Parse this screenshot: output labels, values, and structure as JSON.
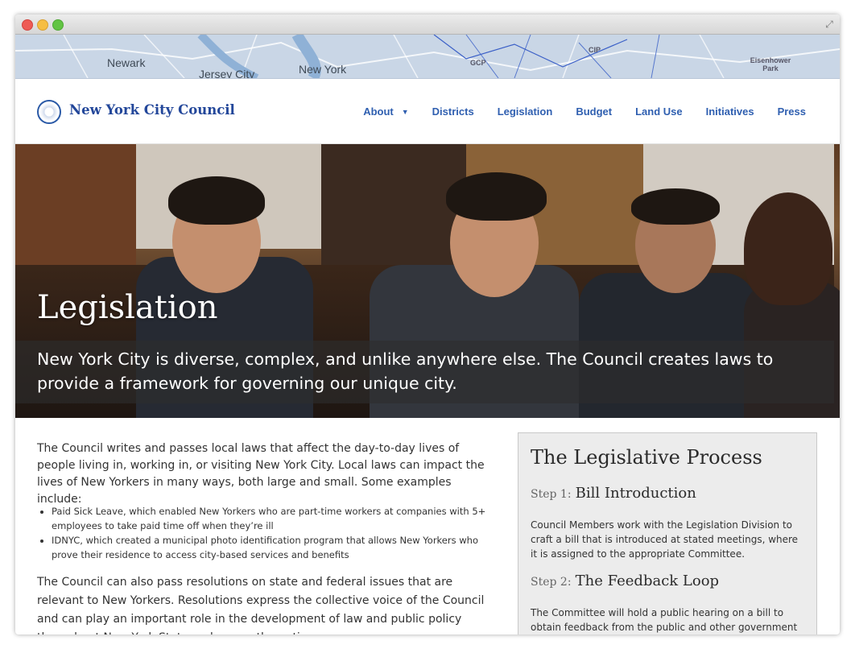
{
  "map": {
    "labels": [
      "Newark",
      "Jersey City",
      "New York",
      "CIP",
      "GCP",
      "Eisenhower Park"
    ]
  },
  "header": {
    "brand": "New York City Council",
    "nav": [
      {
        "label": "About"
      },
      {
        "label": "Districts"
      },
      {
        "label": "Legislation"
      },
      {
        "label": "Budget"
      },
      {
        "label": "Land Use"
      },
      {
        "label": "Initiatives"
      },
      {
        "label": "Press"
      }
    ]
  },
  "hero": {
    "title": "Legislation",
    "subtitle": "New York City is diverse, complex, and unlike anywhere else. The Council creates laws to provide a framework for governing our unique city."
  },
  "main": {
    "intro": "The Council writes and passes local laws that affect the day-to-day lives of people living in, working in, or visiting New York City. Local laws can impact the lives of New Yorkers in many ways, both large and small. Some examples include:",
    "bullets": [
      "Paid Sick Leave, which enabled New Yorkers who are part-time workers at companies with 5+ employees to take paid time off when they’re ill",
      "IDNYC, which created a municipal photo identification program that allows New Yorkers who prove their residence to access city-based services and benefits"
    ],
    "para2": "The Council can also pass resolutions on state and federal issues that are relevant to New Yorkers. Resolutions express the collective voice of the Council and can play an important role in the development of law and public policy throughout New York State and across the nation."
  },
  "sidebar": {
    "title": "The Legislative Process",
    "steps": [
      {
        "num": "Step 1:",
        "name": "Bill Introduction",
        "desc": "Council Members work with the Legislation Division to craft a bill that is introduced at stated meetings, where it is assigned to the appropriate Committee."
      },
      {
        "num": "Step 2:",
        "name": "The Feedback Loop",
        "desc": "The Committee will hold a public hearing on a bill to obtain feedback from the public and other government entities who"
      }
    ]
  },
  "colors": {
    "brand_blue": "#23479a",
    "nav_blue": "#2f5fb0",
    "sidebar_bg": "#ececec"
  }
}
